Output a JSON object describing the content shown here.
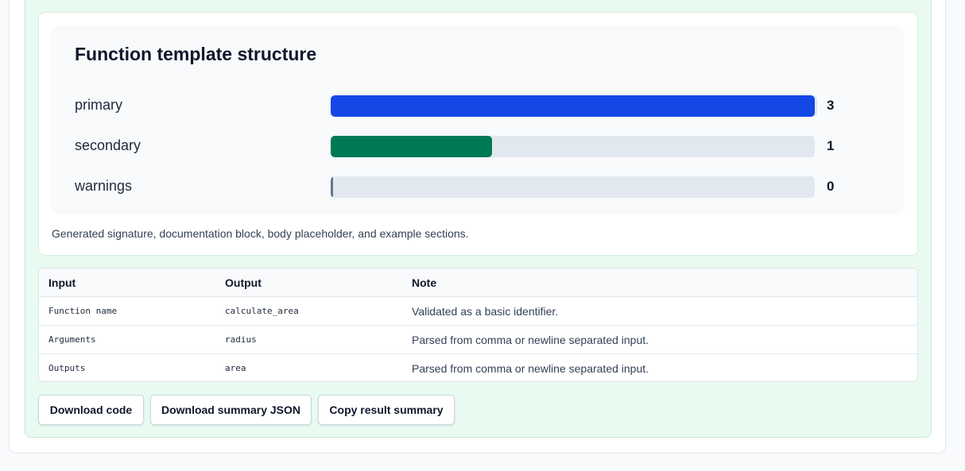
{
  "chart_data": {
    "type": "bar",
    "title": "Function template structure",
    "categories": [
      "primary",
      "secondary",
      "warnings"
    ],
    "values": [
      3,
      1,
      0
    ],
    "xlim": [
      0,
      3
    ],
    "colors": [
      "#1447e6",
      "#007a55",
      "#62748e"
    ]
  },
  "caption": "Generated signature, documentation block, body placeholder, and example sections.",
  "table": {
    "headers": [
      "Input",
      "Output",
      "Note"
    ],
    "rows": [
      [
        "Function name",
        "calculate_area",
        "Validated as a basic identifier."
      ],
      [
        "Arguments",
        "radius",
        "Parsed from comma or newline separated input."
      ],
      [
        "Outputs",
        "area",
        "Parsed from comma or newline separated input."
      ]
    ]
  },
  "buttons": {
    "download_code": "Download code",
    "download_summary_json": "Download summary JSON",
    "copy_result_summary": "Copy result summary"
  }
}
